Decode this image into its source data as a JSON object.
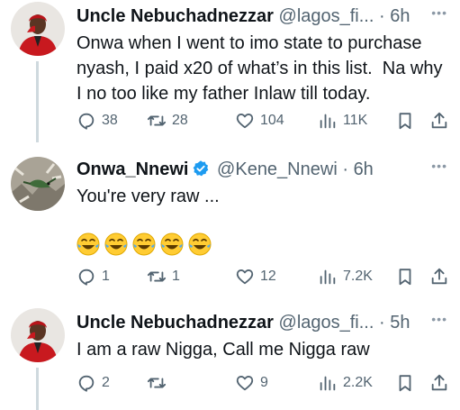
{
  "tweets": [
    {
      "name": "Uncle Nebuchadnezzar",
      "handle": "@lagos_fi...",
      "dot": "·",
      "time": "6h",
      "verified": false,
      "text": "Onwa when I went to imo state to purchase nyash, I paid x20 of what’s in this list.  Na why I no too like my father Inlaw till today.",
      "actions": {
        "replies": "38",
        "reposts": "28",
        "likes": "104",
        "views": "11K"
      },
      "avatar_icon": "red-suit-person-avatar"
    },
    {
      "name": "Onwa_Nnewi",
      "handle": "@Kene_Nnewi",
      "dot": "·",
      "time": "6h",
      "verified": true,
      "text": "You're very raw ...",
      "emojis": [
        "😂",
        "😂",
        "😂",
        "😂",
        "😂"
      ],
      "actions": {
        "replies": "1",
        "reposts": "1",
        "likes": "12",
        "views": "7.2K"
      },
      "avatar_icon": "lizard-photo-avatar"
    },
    {
      "name": "Uncle Nebuchadnezzar",
      "handle": "@lagos_fi...",
      "dot": "·",
      "time": "5h",
      "verified": false,
      "text": "I am a raw Nigga, Call me Nigga raw",
      "actions": {
        "replies": "2",
        "reposts": "",
        "likes": "9",
        "views": "2.2K"
      },
      "avatar_icon": "red-suit-person-avatar"
    }
  ],
  "more_label": "•••",
  "colors": {
    "text": "#0f1419",
    "muted": "#536471",
    "line": "#cfd9de",
    "verified": "#1d9bf0"
  }
}
